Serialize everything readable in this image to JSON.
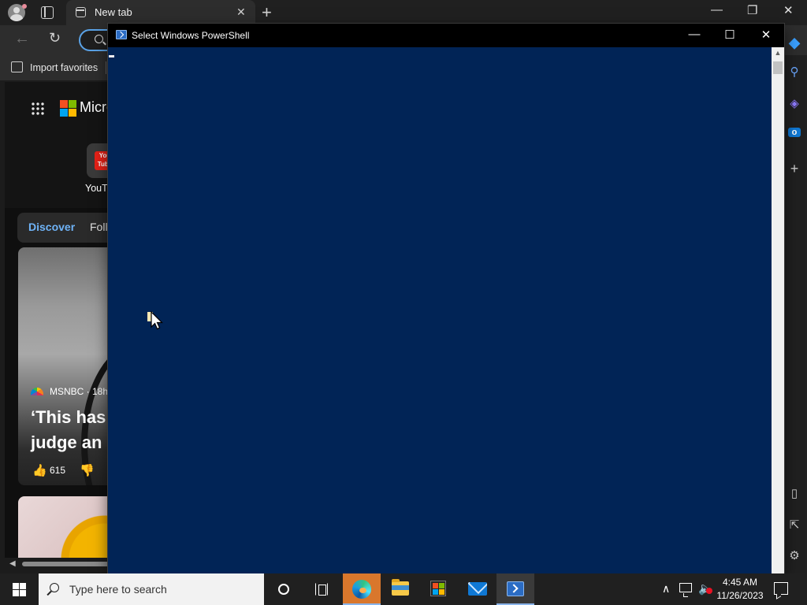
{
  "browser": {
    "tab_title": "New tab",
    "tab_close_glyph": "✕",
    "new_tab_glyph": "+",
    "window_controls": {
      "minimize": "—",
      "restore": "❐",
      "close": "✕"
    },
    "nav": {
      "back_glyph": "←",
      "refresh_glyph": "↻"
    },
    "favorites": {
      "import_label": "Import favorites"
    },
    "new_tab_page": {
      "brand": "Micro",
      "quick_link_label": "YouTu",
      "quick_link_icon_text": "You Tube",
      "feed_tabs": [
        "Discover",
        "Follo"
      ],
      "card": {
        "source": "MSNBC · 18h",
        "headline": "‘This has",
        "headline_line2": "judge an",
        "likes": "615"
      }
    },
    "sidebar_icons": [
      "copilot-icon",
      "search-icon",
      "games-icon",
      "outlook-icon",
      "add-icon",
      "split-screen-icon",
      "share-icon",
      "settings-icon"
    ]
  },
  "powershell": {
    "title": "Select Windows PowerShell",
    "controls": {
      "minimize": "—",
      "maximize": "☐",
      "close": "✕"
    },
    "background_color": "#012456"
  },
  "taskbar": {
    "search_placeholder": "Type here to search",
    "pinned": [
      "cortana-icon",
      "task-view-icon",
      "edge-icon",
      "file-explorer-icon",
      "store-icon",
      "mail-icon",
      "powershell-icon"
    ],
    "active_app": "powershell-icon",
    "tray": {
      "chevron_glyph": "∧",
      "volume_glyph": "🔈",
      "time": "4:45 AM",
      "date": "11/26/2023"
    }
  }
}
